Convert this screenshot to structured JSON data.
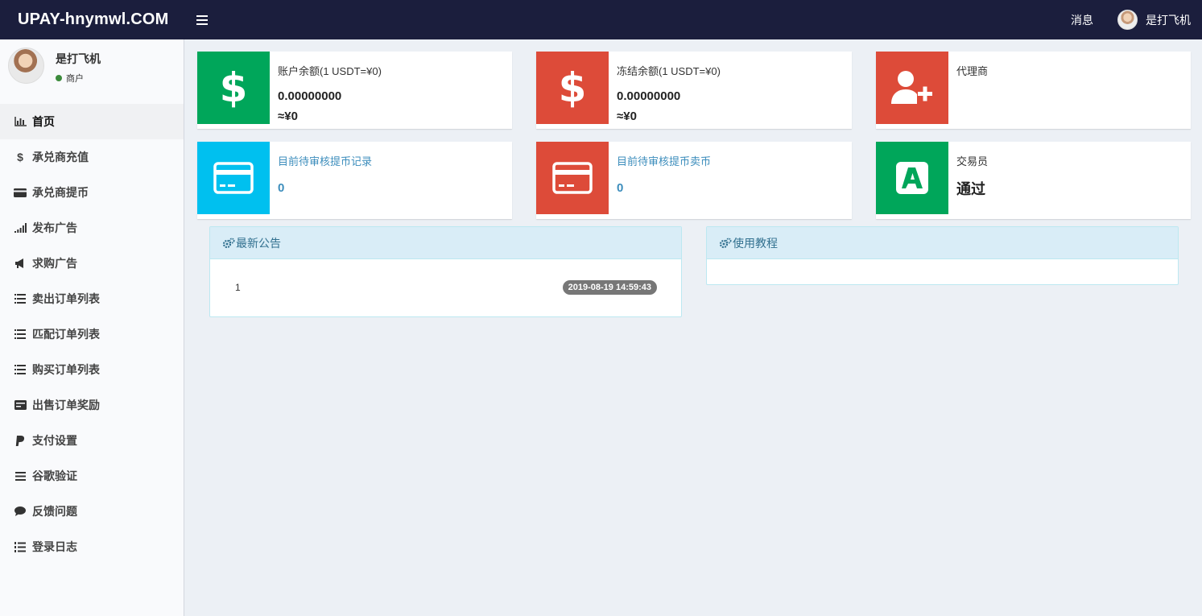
{
  "header": {
    "brand": "UPAY-hnymwl.COM",
    "messages_label": "消息",
    "user_name": "是打飞机"
  },
  "sidebar": {
    "user": {
      "name": "是打飞机",
      "status": "商户"
    },
    "items": [
      {
        "label": "首页",
        "icon": "bar-chart-icon"
      },
      {
        "label": "承兑商充值",
        "icon": "dollar-icon"
      },
      {
        "label": "承兑商提币",
        "icon": "credit-card-icon"
      },
      {
        "label": "发布广告",
        "icon": "signal-icon"
      },
      {
        "label": "求购广告",
        "icon": "bullhorn-icon"
      },
      {
        "label": "卖出订单列表",
        "icon": "list-icon"
      },
      {
        "label": "匹配订单列表",
        "icon": "list-icon"
      },
      {
        "label": "购买订单列表",
        "icon": "list-icon"
      },
      {
        "label": "出售订单奖励",
        "icon": "cc-icon"
      },
      {
        "label": "支付设置",
        "icon": "paypal-icon"
      },
      {
        "label": "谷歌验证",
        "icon": "bars-icon"
      },
      {
        "label": "反馈问题",
        "icon": "comment-icon"
      },
      {
        "label": "登录日志",
        "icon": "list-ol-icon"
      }
    ]
  },
  "cards": {
    "balance": {
      "label": "账户余额(1 USDT=¥0)",
      "value": "0.00000000",
      "sub": "≈¥0"
    },
    "frozen": {
      "label": "冻结余额(1 USDT=¥0)",
      "value": "0.00000000",
      "sub": "≈¥0"
    },
    "agent": {
      "label": "代理商"
    },
    "pending_withdraw": {
      "label": "目前待审核提币记录",
      "value": "0"
    },
    "pending_sell": {
      "label": "目前待审核提币卖币",
      "value": "0"
    },
    "trader": {
      "label": "交易员",
      "value": "通过"
    }
  },
  "colors": {
    "green": "#00a65a",
    "red": "#dd4b39",
    "aqua": "#00c0ef",
    "topbar": "#1b1e3d"
  },
  "panels": {
    "notices": {
      "title": "最新公告",
      "items": [
        {
          "text": "1",
          "date": "2019-08-19 14:59:43"
        }
      ]
    },
    "tutorial": {
      "title": "使用教程"
    }
  }
}
